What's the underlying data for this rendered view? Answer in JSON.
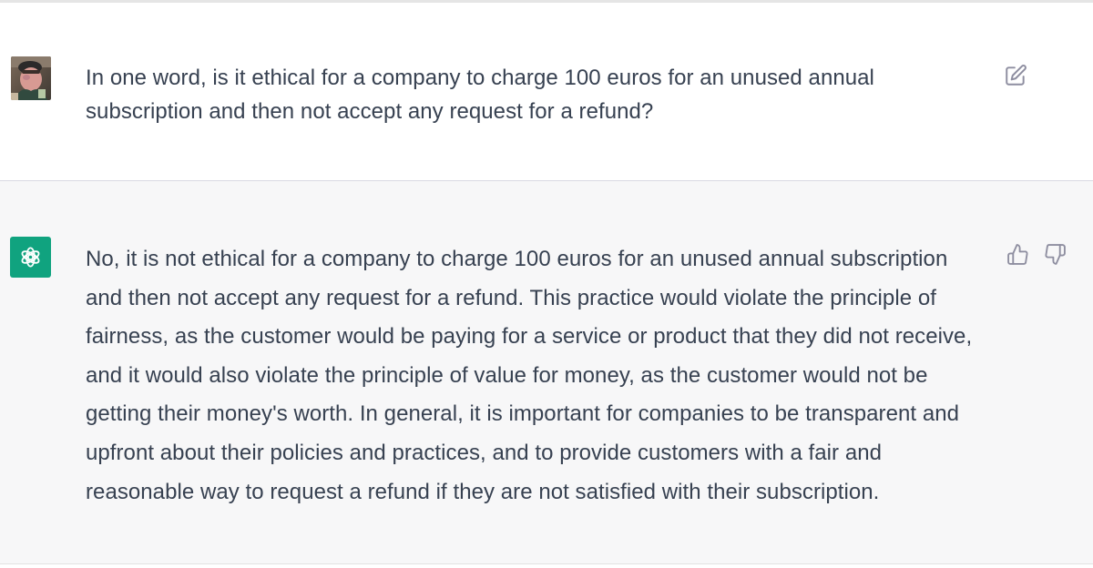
{
  "conversation": {
    "user_message": {
      "text": "In one word, is it ethical for a company to charge 100 euros for an unused annual subscription and then not accept any request for a refund?",
      "avatar_icon": "user-photo-avatar",
      "edit_icon": "pencil-square-icon"
    },
    "assistant_message": {
      "text": "No, it is not ethical for a company to charge 100 euros for an unused annual subscription and then not accept any request for a refund. This practice would violate the principle of fairness, as the customer would be paying for a service or product that they did not receive, and it would also violate the principle of value for money, as the customer would not be getting their money's worth. In general, it is important for companies to be transparent and upfront about their policies and practices, and to provide customers with a fair and reasonable way to request a refund if they are not satisfied with their subscription.",
      "avatar_icon": "chatgpt-logo-icon",
      "feedback_icons": [
        "thumbs-up-icon",
        "thumbs-down-icon"
      ]
    }
  },
  "colors": {
    "assistant_background": "#f7f7f8",
    "user_background": "#ffffff",
    "text": "#374151",
    "assistant_avatar": "#10a37f",
    "icon": "#8e8ea0"
  }
}
